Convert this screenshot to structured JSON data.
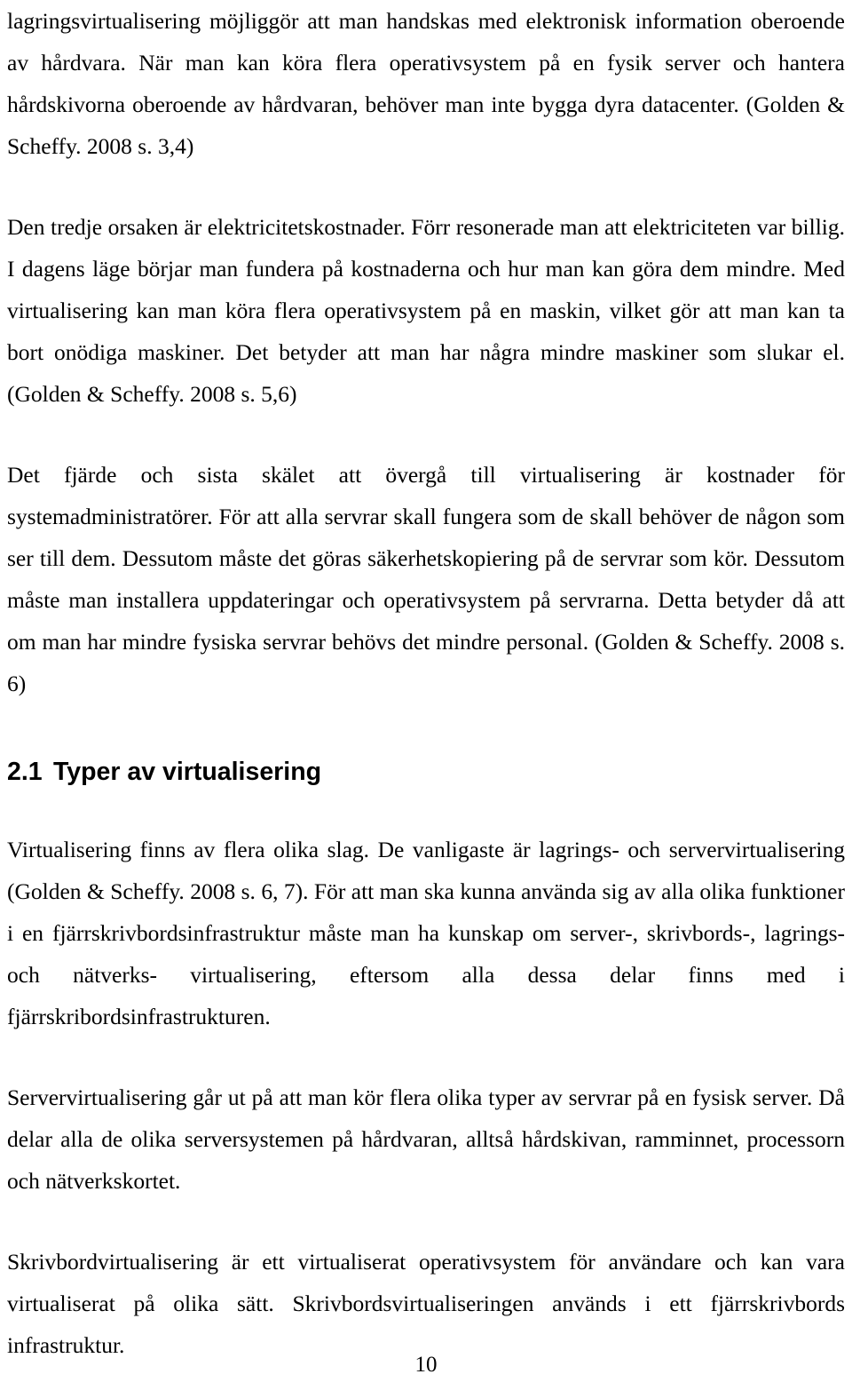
{
  "document": {
    "page_number": "10",
    "paragraphs": [
      {
        "id": "para-1",
        "text": "lagringsvirtualisering möjliggör att man handskas med elektronisk information oberoende av hårdvara. När man kan köra flera operativsystem på en fysik server och hantera hårdskivorna oberoende av hårdvaran, behöver man inte bygga dyra datacenter. (Golden &  Scheffy. 2008 s. 3,4)"
      },
      {
        "id": "para-2",
        "text": "Den tredje orsaken är elektricitetskostnader. Förr resonerade man att elektriciteten var billig. I dagens läge börjar man fundera på kostnaderna och hur man kan göra dem mindre. Med virtualisering kan man köra flera operativsystem på en maskin, vilket gör att man kan ta bort onödiga maskiner. Det betyder att man har några mindre maskiner som slukar el. (Golden &  Scheffy. 2008 s. 5,6)"
      },
      {
        "id": "para-3",
        "text": "Det fjärde och sista skälet att övergå till virtualisering är kostnader för systemadministratörer. För att alla servrar skall fungera som de skall behöver de någon som ser till dem. Dessutom måste det göras säkerhetskopiering på de servrar som kör. Dessutom måste man installera uppdateringar och operativsystem på servrarna. Detta betyder då att om man har mindre fysiska servrar behövs det mindre personal. (Golden &  Scheffy. 2008 s. 6)"
      },
      {
        "id": "para-4",
        "text": "Virtualisering finns av flera olika slag. De vanligaste är lagrings- och servervirtualisering (Golden &  Scheffy. 2008 s. 6, 7). För att man ska kunna använda sig av alla olika funktioner i en fjärrskrivbordsinfrastruktur måste man ha kunskap om server-, skrivbords-, lagrings- och nätverks- virtualisering, eftersom alla dessa delar finns med i fjärrskribordsinfrastrukturen."
      },
      {
        "id": "para-5",
        "text": "Servervirtualisering går ut på att man kör flera olika typer av servrar på en fysisk server. Då delar alla de olika serversystemen på hårdvaran, alltså hårdskivan, ramminnet, processorn och nätverkskortet."
      },
      {
        "id": "para-6",
        "text": "Skrivbordvirtualisering är ett virtualiserat operativsystem för användare och kan vara virtualiserat på olika sätt. Skrivbordsvirtualiseringen används i ett fjärrskrivbords infrastruktur."
      }
    ],
    "heading": {
      "number": "2.1",
      "title": "Typer av virtualisering"
    }
  }
}
